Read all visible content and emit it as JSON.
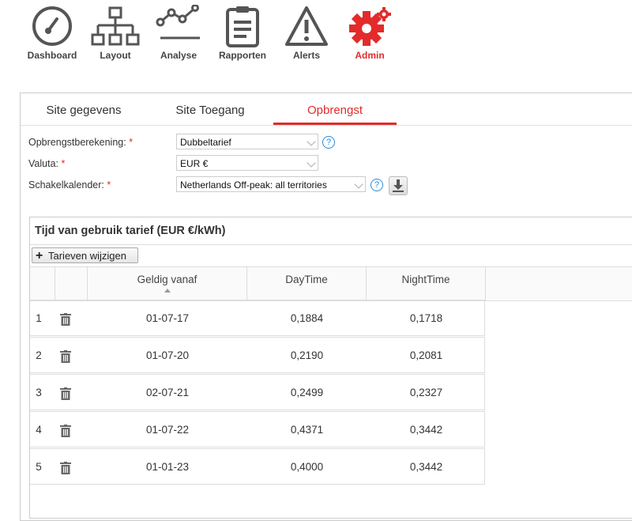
{
  "nav": {
    "items": [
      {
        "label": "Dashboard",
        "icon": "gauge-icon"
      },
      {
        "label": "Layout",
        "icon": "sitemap-icon"
      },
      {
        "label": "Analyse",
        "icon": "line-chart-icon"
      },
      {
        "label": "Rapporten",
        "icon": "clipboard-icon"
      },
      {
        "label": "Alerts",
        "icon": "warning-icon"
      },
      {
        "label": "Admin",
        "icon": "gear-icon",
        "active": true
      }
    ],
    "accent": "#e32b2b"
  },
  "tabs": [
    {
      "label": "Site gegevens"
    },
    {
      "label": "Site Toegang"
    },
    {
      "label": "Opbrengst",
      "active": true
    }
  ],
  "form": {
    "calc_label": "Opbrengstberekening:",
    "calc_value": "Dubbeltarief",
    "currency_label": "Valuta:",
    "currency_value": "EUR €",
    "calendar_label": "Schakelkalender:",
    "calendar_value": "Netherlands Off-peak: all territories",
    "required_mark": "*",
    "help": "?"
  },
  "tariff": {
    "title": "Tijd van gebruik tarief (EUR €/kWh)",
    "edit_button": "Tarieven wijzigen",
    "columns": {
      "valid_from": "Geldig vanaf",
      "day": "DayTime",
      "night": "NightTime"
    },
    "rows": [
      {
        "n": "1",
        "date": "01-07-17",
        "day": "0,1884",
        "night": "0,1718"
      },
      {
        "n": "2",
        "date": "01-07-20",
        "day": "0,2190",
        "night": "0,2081"
      },
      {
        "n": "3",
        "date": "02-07-21",
        "day": "0,2499",
        "night": "0,2327"
      },
      {
        "n": "4",
        "date": "01-07-22",
        "day": "0,4371",
        "night": "0,3442"
      },
      {
        "n": "5",
        "date": "01-01-23",
        "day": "0,4000",
        "night": "0,3442"
      }
    ]
  }
}
